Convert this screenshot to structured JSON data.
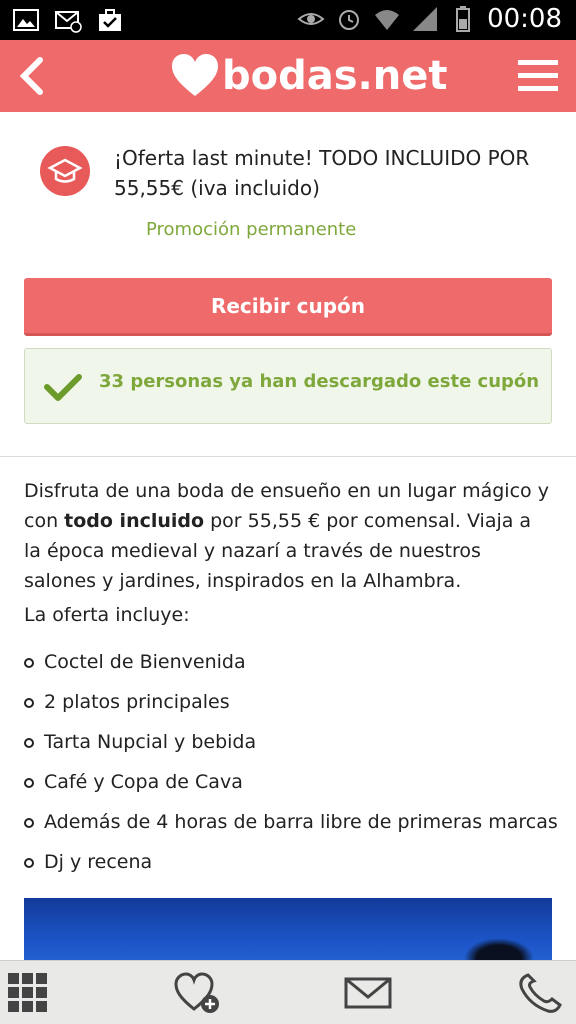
{
  "status_bar": {
    "time": "00:08",
    "icons": [
      "image-icon",
      "email-icon",
      "briefcase-icon",
      "eye-icon",
      "alarm-icon",
      "wifi-icon",
      "signal-icon",
      "battery-icon"
    ]
  },
  "header": {
    "logo_text": "bodas.net",
    "brand_color": "#ef6a6a",
    "back_icon": "chevron-left-icon",
    "menu_icon": "hamburger-icon"
  },
  "offer": {
    "icon": "graduation-cap-icon",
    "title": "¡Oferta last minute! TODO INCLUIDO POR 55,55€ (iva incluido)",
    "subtitle": "Promoción permanente"
  },
  "cta": {
    "label": "Recibir cupón"
  },
  "downloads": {
    "icon": "check-icon",
    "text": "33 personas ya han descargado este cupón"
  },
  "description": {
    "part1": "Disfruta de una boda de ensueño en un lugar mágico y con ",
    "bold": "todo incluido",
    "part2": " por 55,55 € por comensal. Viaja a la época medieval y nazarí a través de nuestros salones y jardines, inspirados en la Alhambra."
  },
  "includes": {
    "title": "La oferta incluye:",
    "items": [
      "Coctel de Bienvenida",
      "2 platos principales",
      "Tarta Nupcial y bebida",
      "Café y Copa de Cava",
      "Además de 4 horas de barra libre de primeras marcas",
      "Dj y recena"
    ]
  },
  "bottom_bar": {
    "items": [
      "grid-menu-icon",
      "favorite-add-icon",
      "mail-icon",
      "phone-icon"
    ]
  }
}
